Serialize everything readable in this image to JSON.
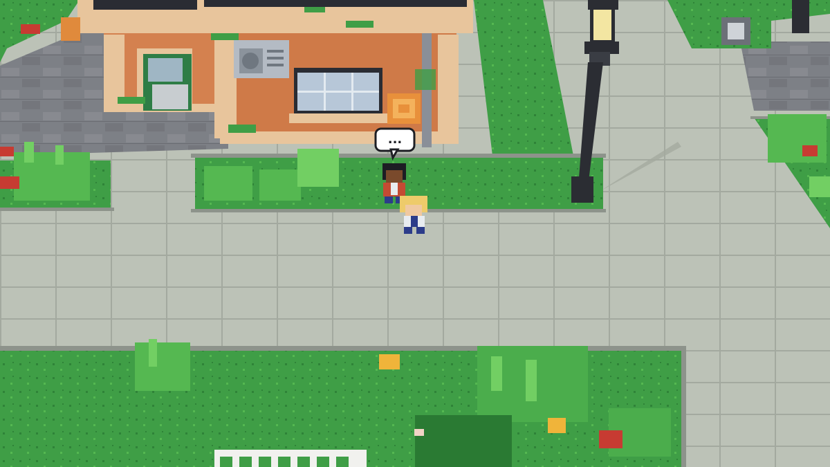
{
  "scene": {
    "type": "top-down voxel town street",
    "hud_visible": false,
    "speech_bubble_text": "...",
    "colors": {
      "pavement": "#bcc2b7",
      "pavement_line": "#9fa69c",
      "curb": "#8d938b",
      "road": "#7d7f84",
      "road_dark": "#6a6c72",
      "grass": "#3f9e46",
      "grass_dark": "#2f8338",
      "grass_light": "#5fc05a",
      "wall": "#d4814f",
      "wall_trim": "#e8c59c",
      "roof": "#2a2c33",
      "lamp_post": "#2b2d33",
      "lamp_light": "#f3e6a2",
      "flower_red": "#c73b32",
      "flower_yellow": "#f0b43a",
      "fence": "#f1f1ee"
    }
  },
  "characters": [
    {
      "name": "dark-haired-npc",
      "role": "npc",
      "talking": true
    },
    {
      "name": "blonde-player",
      "role": "player",
      "talking": false
    }
  ]
}
